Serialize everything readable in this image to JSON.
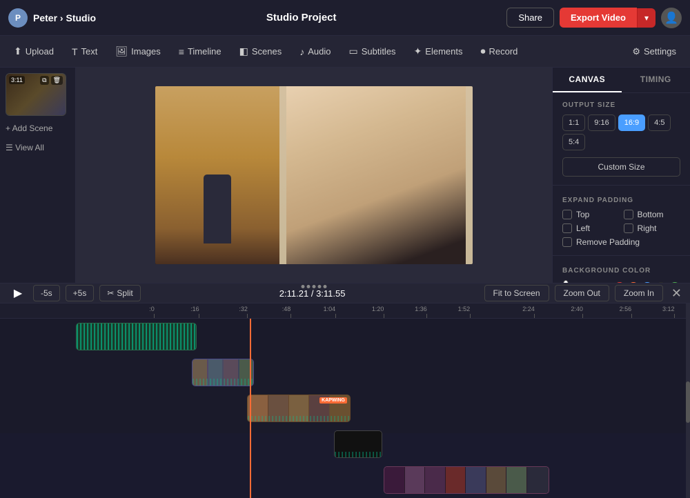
{
  "topbar": {
    "avatar_initials": "P",
    "breadcrumb_user": "Peter",
    "breadcrumb_sep": "›",
    "breadcrumb_app": "Studio",
    "project_title": "Studio Project",
    "share_label": "Share",
    "export_label": "Export Video",
    "export_chevron": "▾"
  },
  "toolbar": {
    "items": [
      {
        "id": "upload",
        "icon": "⬆",
        "label": "Upload"
      },
      {
        "id": "text",
        "icon": "T",
        "label": "Text"
      },
      {
        "id": "images",
        "icon": "🖼",
        "label": "Images"
      },
      {
        "id": "timeline",
        "icon": "≡",
        "label": "Timeline"
      },
      {
        "id": "scenes",
        "icon": "◧",
        "label": "Scenes"
      },
      {
        "id": "audio",
        "icon": "♪",
        "label": "Audio"
      },
      {
        "id": "subtitles",
        "icon": "▭",
        "label": "Subtitles"
      },
      {
        "id": "elements",
        "icon": "✦",
        "label": "Elements"
      },
      {
        "id": "record",
        "icon": "⏺",
        "label": "Record"
      }
    ],
    "settings_label": "Settings"
  },
  "scene_panel": {
    "scene_time": "3:11",
    "add_scene_label": "+ Add Scene",
    "view_all_label": "☰ View All"
  },
  "right_panel": {
    "tab_canvas": "CANVAS",
    "tab_timing": "TIMING",
    "output_size_title": "OUTPUT SIZE",
    "ratios": [
      "1:1",
      "9:16",
      "16:9",
      "4:5",
      "5:4"
    ],
    "active_ratio": "16:9",
    "custom_size_label": "Custom Size",
    "expand_padding_title": "EXPAND PADDING",
    "padding_options": [
      "Top",
      "Bottom",
      "Left",
      "Right"
    ],
    "remove_padding_label": "Remove Padding",
    "background_color_title": "BACKGROUND COLOR",
    "color_hex": "#ffffff",
    "swatches": [
      "#e53935",
      "#ff6b35",
      "#4a9eff",
      "#2a2a2a",
      "#4caf50"
    ]
  },
  "timeline_controls": {
    "play_icon": "▶",
    "skip_back_label": "-5s",
    "skip_fwd_label": "+5s",
    "split_label": "Split",
    "split_icon": "✂",
    "current_time": "2:11.21",
    "total_time": "3:11.55",
    "fit_screen_label": "Fit to Screen",
    "zoom_out_label": "Zoom Out",
    "zoom_in_label": "Zoom In",
    "close_icon": "✕"
  },
  "timeline_ruler": {
    "marks": [
      {
        "label": ":0",
        "pct": 0
      },
      {
        "label": ":16",
        "pct": 8
      },
      {
        "label": ":32",
        "pct": 17
      },
      {
        "label": ":48",
        "pct": 25
      },
      {
        "label": "1:04",
        "pct": 33
      },
      {
        "label": "1:20",
        "pct": 42
      },
      {
        "label": "1:36",
        "pct": 50
      },
      {
        "label": "1:52",
        "pct": 58
      },
      {
        "label": "2:24",
        "pct": 71
      },
      {
        "label": "2:40",
        "pct": 79
      },
      {
        "label": "2:56",
        "pct": 88
      },
      {
        "label": "3:12",
        "pct": 96
      }
    ]
  }
}
